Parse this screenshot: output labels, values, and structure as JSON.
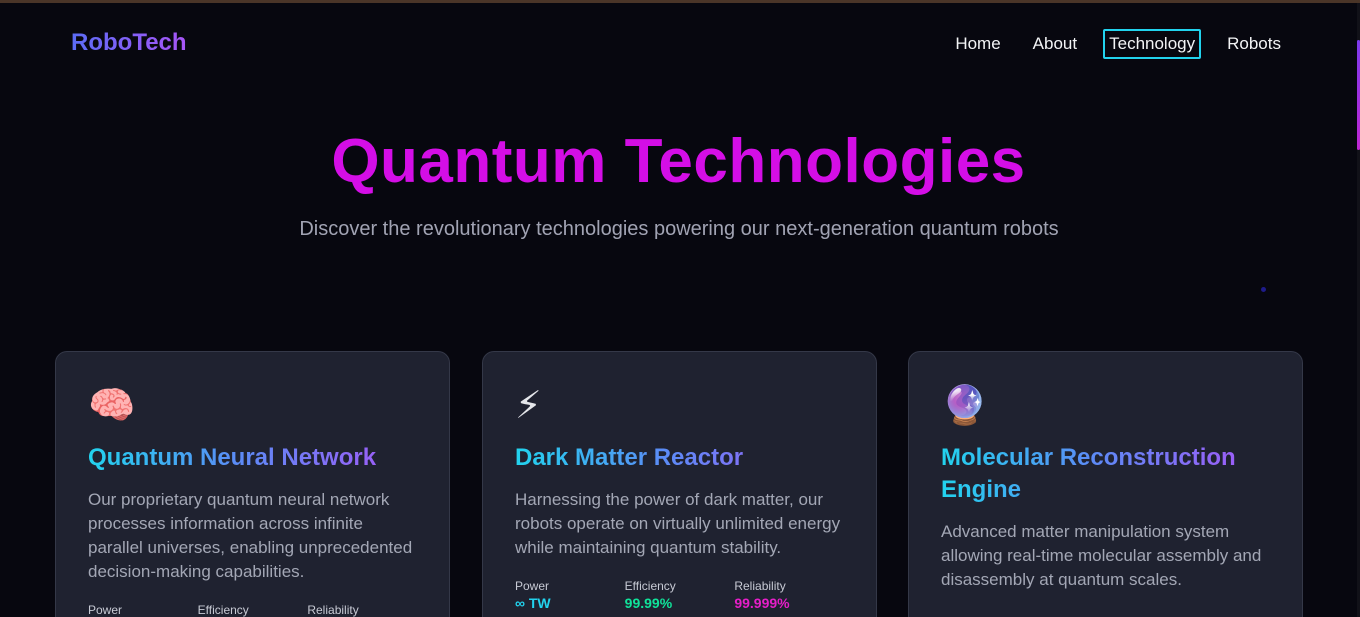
{
  "brand": {
    "logo": "RoboTech"
  },
  "nav": {
    "links": [
      {
        "label": "Home"
      },
      {
        "label": "About"
      },
      {
        "label": "Technology",
        "active": true
      },
      {
        "label": "Robots"
      }
    ]
  },
  "hero": {
    "title": "Quantum Technologies",
    "subtitle": "Discover the revolutionary technologies powering our next-generation quantum robots"
  },
  "cards": [
    {
      "icon": "🧠",
      "icon_name": "brain-icon",
      "title": "Quantum Neural Network",
      "description": "Our proprietary quantum neural network processes information across infinite parallel universes, enabling unprecedented decision-making capabilities.",
      "stats": [
        {
          "label": "Power",
          "value": ""
        },
        {
          "label": "Efficiency",
          "value": ""
        },
        {
          "label": "Reliability",
          "value": ""
        }
      ]
    },
    {
      "icon": "⚡",
      "icon_name": "lightning-icon",
      "title": "Dark Matter Reactor",
      "description": "Harnessing the power of dark matter, our robots operate on virtually unlimited energy while maintaining quantum stability.",
      "stats": [
        {
          "label": "Power",
          "value": "∞ TW"
        },
        {
          "label": "Efficiency",
          "value": "99.99%"
        },
        {
          "label": "Reliability",
          "value": "99.999%"
        }
      ]
    },
    {
      "icon": "🔮",
      "icon_name": "crystal-ball-icon",
      "title": "Molecular Reconstruction Engine",
      "description": "Advanced matter manipulation system allowing real-time molecular assembly and disassembly at quantum scales."
    }
  ],
  "colors": {
    "background": "#07070f",
    "card": "#1f2230",
    "accent_magenta": "#d40ee6",
    "accent_cyan": "#22d3ee",
    "stat_green": "#10e39a",
    "stat_pink": "#e61ec8"
  }
}
